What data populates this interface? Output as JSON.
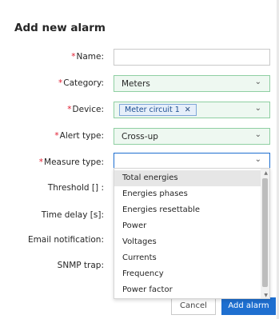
{
  "dialog": {
    "title": "Add new alarm"
  },
  "form": {
    "required_marker": "*",
    "name_label": "Name:",
    "name_value": "",
    "category_label": "Category:",
    "category_value": "Meters",
    "device_label": "Device:",
    "device_tag": "Meter circuit 1",
    "device_tag_remove": "✕",
    "alert_type_label": "Alert type:",
    "alert_type_value": "Cross-up",
    "measure_type_label": "Measure type:",
    "measure_type_value": "",
    "threshold_label": "Threshold [] :",
    "time_delay_label": "Time delay [s]:",
    "email_label": "Email notification:",
    "snmp_label": "SNMP trap:"
  },
  "measure_dropdown": {
    "options": [
      "Total energies",
      "Energies phases",
      "Energies resettable",
      "Power",
      "Voltages",
      "Currents",
      "Frequency",
      "Power factor"
    ],
    "highlighted_index": 0
  },
  "buttons": {
    "cancel_label": "Cancel",
    "add_label": "Add alarm"
  },
  "icons": {
    "chevron": "chevron-down-icon",
    "scroll_up": "scroll-up-arrow-icon",
    "scroll_down": "scroll-down-arrow-icon"
  },
  "colors": {
    "required": "#e01b2f",
    "selected_bg": "#eef8f1",
    "selected_border": "#8fcfa2",
    "focus_border": "#1e6fd0",
    "primary_button": "#1e6fd0",
    "tag_bg": "#e6effa",
    "tag_border": "#7ea6d8"
  }
}
